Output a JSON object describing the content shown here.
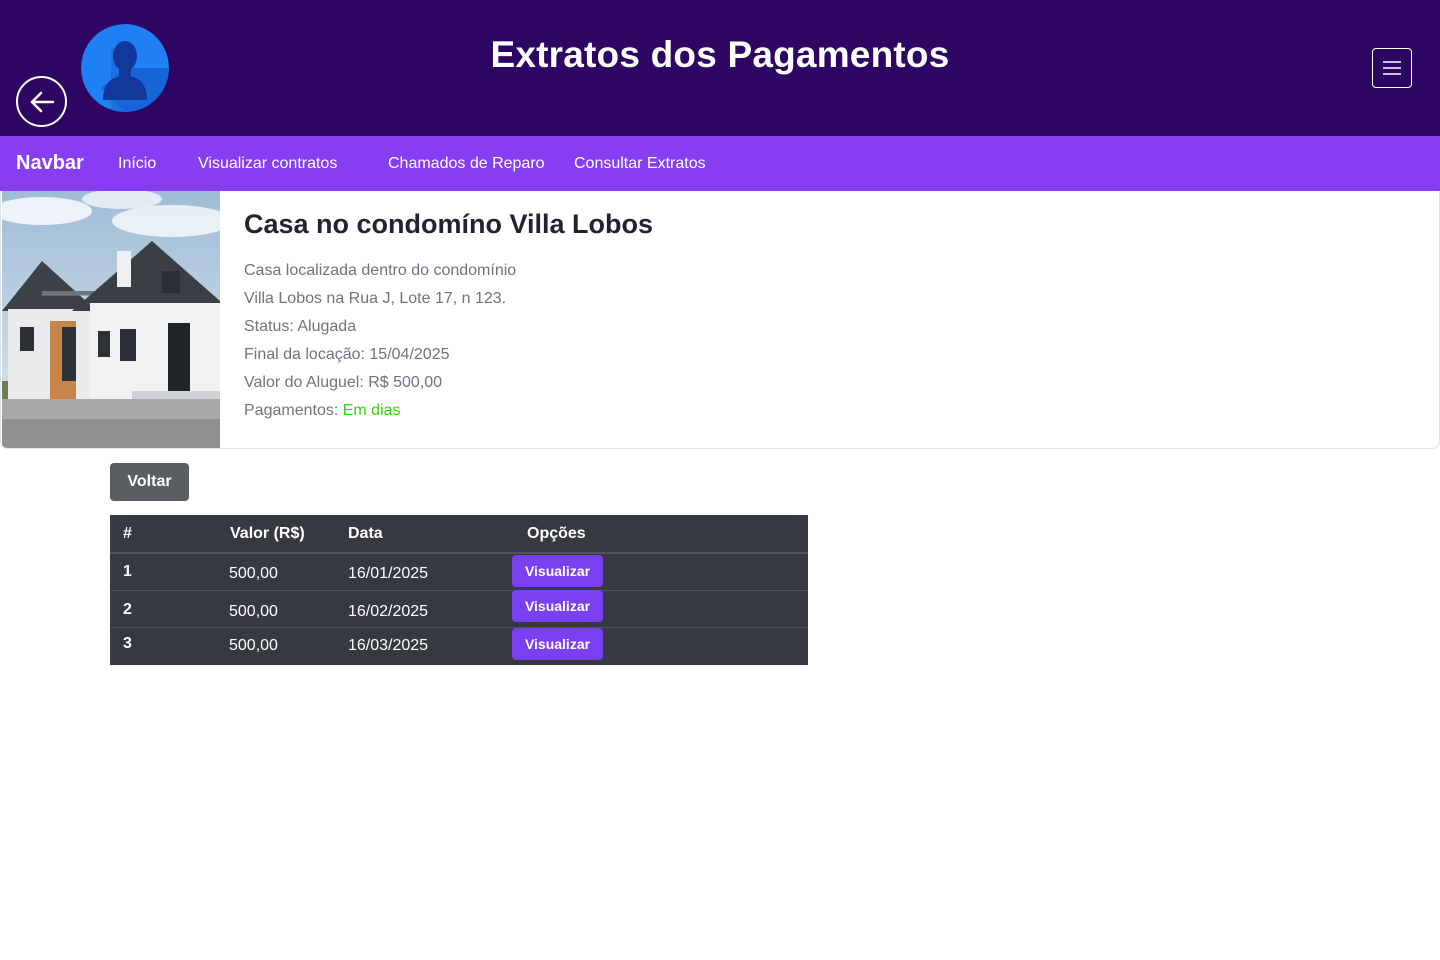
{
  "header": {
    "title": "Extratos dos Pagamentos",
    "back_icon": "arrow-left-circle-icon",
    "avatar_icon": "user-avatar-icon",
    "menu_icon": "hamburger-menu-icon",
    "background_color": "#2c0662"
  },
  "navbar": {
    "brand": "Navbar",
    "links": [
      "Início",
      "Visualizar contratos",
      "Chamados de Reparo",
      "Consultar Extratos"
    ],
    "background_color": "#873ef2"
  },
  "property": {
    "title": "Casa no condomíno Villa Lobos",
    "description_line1": "Casa localizada dentro do condomínio",
    "description_line2": "Villa Lobos na Rua J, Lote 17, n 123.",
    "status": "Status: Alugada",
    "end_date": "Final da locação: 15/04/2025",
    "rent_value": "Valor do Aluguel: R$ 500,00",
    "payments_label": "Pagamentos:",
    "payments_status": "Em dias",
    "payments_status_color": "#35d40b"
  },
  "actions": {
    "back_label": "Voltar"
  },
  "payments_table": {
    "headers": [
      "#",
      "Valor (R$)",
      "Data",
      "Opções"
    ],
    "rows": [
      {
        "index": "1",
        "value": "500,00",
        "date": "16/01/2025",
        "action": "Visualizar"
      },
      {
        "index": "2",
        "value": "500,00",
        "date": "16/02/2025",
        "action": "Visualizar"
      },
      {
        "index": "3",
        "value": "500,00",
        "date": "16/03/2025",
        "action": "Visualizar"
      }
    ],
    "button_color": "#7a40f0",
    "background_color": "#363940"
  }
}
